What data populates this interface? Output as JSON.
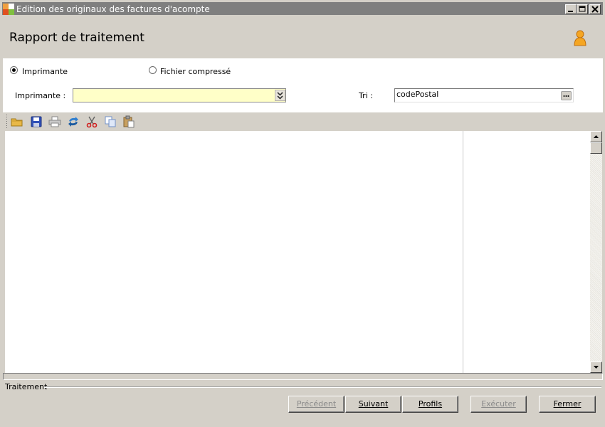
{
  "window": {
    "title": "Edition des originaux des factures d'acompte"
  },
  "header": {
    "title": "Rapport de traitement",
    "user_icon": "user-icon"
  },
  "output_options": {
    "selected": "Imprimante",
    "options": [
      {
        "label": "Imprimante",
        "checked": true
      },
      {
        "label": "Fichier compressé",
        "checked": false
      }
    ]
  },
  "printer": {
    "label": "Imprimante :",
    "value": ""
  },
  "sort": {
    "label": "Tri :",
    "value": "codePostal",
    "browse_label": "..."
  },
  "toolbar": {
    "icons": [
      "open-folder-icon",
      "save-icon",
      "print-icon",
      "refresh-icon",
      "cut-icon",
      "copy-icon",
      "paste-icon"
    ]
  },
  "status": {
    "label": "Traitement"
  },
  "buttons": {
    "previous": {
      "label": "Précédent",
      "enabled": false
    },
    "next": {
      "label": "Suivant",
      "enabled": true
    },
    "profiles": {
      "label": "Profils",
      "enabled": true
    },
    "execute": {
      "label": "Exécuter",
      "enabled": false
    },
    "close": {
      "label": "Fermer",
      "enabled": true
    }
  },
  "colors": {
    "titlebar": "#7f7f7f",
    "chrome": "#d4d0c8",
    "printer_field_bg": "#ffffc8",
    "panel_bg": "#ffffff"
  }
}
